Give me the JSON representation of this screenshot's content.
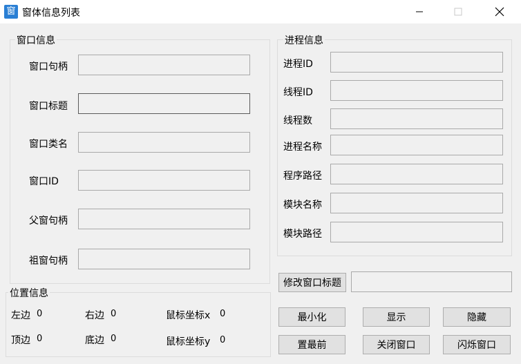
{
  "window": {
    "title": "窗体信息列表",
    "app_icon_glyph": "窗"
  },
  "window_info": {
    "title": "窗口信息",
    "handle_label": "窗口句柄",
    "title_label": "窗口标题",
    "class_label": "窗口类名",
    "id_label": "窗口ID",
    "parent_label": "父窗句柄",
    "root_label": "祖窗句柄"
  },
  "process_info": {
    "title": "进程信息",
    "pid_label": "进程ID",
    "tid_label": "线程ID",
    "thread_count_label": "线程数",
    "name_label": "进程名称",
    "path_label": "程序路径",
    "module_name_label": "模块名称",
    "module_path_label": "模块路径"
  },
  "position_info": {
    "title": "位置信息",
    "left_label": "左边",
    "left_value": "0",
    "right_label": "右边",
    "right_value": "0",
    "top_label": "顶边",
    "top_value": "0",
    "bottom_label": "底边",
    "bottom_value": "0",
    "mouse_x_label": "鼠标坐标x",
    "mouse_x_value": "0",
    "mouse_y_label": "鼠标坐标y",
    "mouse_y_value": "0"
  },
  "buttons": {
    "modify_title": "修改窗口标题",
    "minimize": "最小化",
    "show": "显示",
    "hide": "隐藏",
    "topmost": "置最前",
    "close_window": "关闭窗口",
    "flash_window": "闪烁窗口"
  },
  "colors": {
    "window_bg": "#f0f0f0",
    "titlebar_bg": "#ffffff",
    "field_border": "#a9a9a9",
    "button_bg": "#e1e1e1"
  }
}
